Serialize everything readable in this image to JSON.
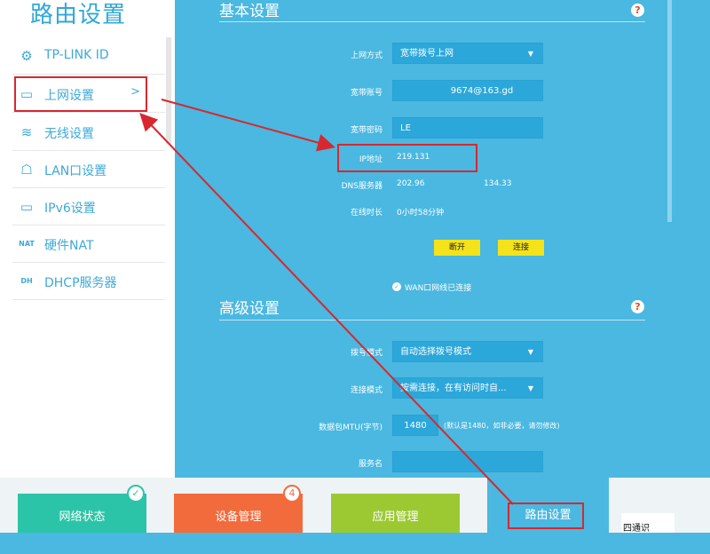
{
  "sidebar": {
    "title": "路由设置",
    "items": [
      {
        "label": "TP-LINK ID",
        "icon": "gear-icon",
        "glyph": "⚙"
      },
      {
        "label": "上网设置",
        "icon": "laptop-icon",
        "glyph": "▭",
        "chevron": ">"
      },
      {
        "label": "无线设置",
        "icon": "wifi-icon",
        "glyph": "≋"
      },
      {
        "label": "LAN口设置",
        "icon": "lan-icon",
        "glyph": "☖"
      },
      {
        "label": "IPv6设置",
        "icon": "laptop-icon",
        "glyph": "▭"
      },
      {
        "label": "硬件NAT",
        "icon": "nat-icon",
        "glyph": "NAT"
      },
      {
        "label": "DHCP服务器",
        "icon": "dhcp-icon",
        "glyph": "DH"
      }
    ]
  },
  "basic": {
    "title": "基本设置",
    "help": "?",
    "access_mode_label": "上网方式",
    "access_mode_value": "宽带拨号上网",
    "account_label": "宽带账号",
    "account_value": "9674@163.gd",
    "password_label": "宽带密码",
    "password_value": "LE",
    "ip_label": "IP地址",
    "ip_value": "219.131",
    "dns_label": "DNS服务器",
    "dns_value_1": "202.96",
    "dns_value_2": "134.33",
    "online_label": "在线时长",
    "online_value": "0小时58分钟",
    "disconnect": "断开",
    "connect": "连接",
    "wan_status": "WAN口网线已连接"
  },
  "advanced": {
    "title": "高级设置",
    "help": "?",
    "dial_mode_label": "拨号模式",
    "dial_mode_value": "自动选择拨号模式",
    "conn_mode_label": "连接模式",
    "conn_mode_value": "按需连接，在有访问时自...",
    "mtu_label": "数据包MTU(字节)",
    "mtu_value": "1480",
    "mtu_hint": "(默认是1480，如非必要，请勿修改)",
    "service_label": "服务名"
  },
  "bottom": {
    "tiles": [
      {
        "label": "网络状态",
        "color": "#2cc4a8",
        "badge": "✓"
      },
      {
        "label": "设备管理",
        "color": "#f26b3c",
        "badge": "4"
      },
      {
        "label": "应用管理",
        "color": "#9cc932",
        "badge": ""
      },
      {
        "label": "路由设置",
        "color": "#4ab8e0",
        "badge": ""
      }
    ],
    "qr_text": "四通识"
  },
  "colors": {
    "accent": "#2fa8d8",
    "highlight": "#d7282f"
  }
}
